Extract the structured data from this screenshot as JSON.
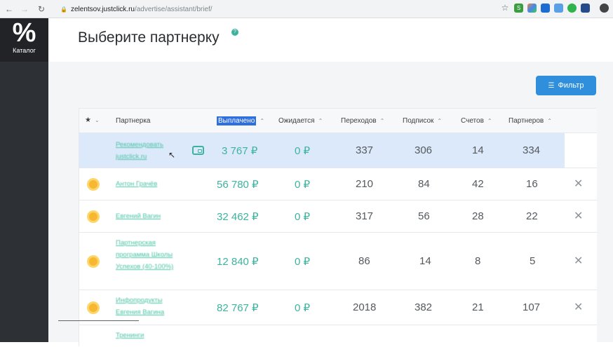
{
  "browser": {
    "url_host": "zelentsov.justclick.ru",
    "url_path": "/advertise/assistant/brief/"
  },
  "sidebar": {
    "catalog_symbol": "%",
    "catalog_label": "Каталог"
  },
  "page": {
    "title": "Выберите партнерку",
    "help_glyph": "?",
    "filter_label": "Фильтр"
  },
  "table": {
    "headers": {
      "star": "★",
      "partner": "Партнерка",
      "paid": "Выплачено",
      "pending": "Ожидается",
      "clicks": "Переходов",
      "subscribers": "Подписок",
      "invoices": "Счетов",
      "partners": "Партнеров"
    },
    "rows": [
      {
        "partner": "Рекомендовать justclick.ru",
        "paid": "3 767 ₽",
        "pending": "0 ₽",
        "clicks": "337",
        "subscribers": "306",
        "invoices": "14",
        "partners": "334"
      },
      {
        "partner": "Антон Грачёв",
        "paid": "56 780 ₽",
        "pending": "0 ₽",
        "clicks": "210",
        "subscribers": "84",
        "invoices": "42",
        "partners": "16"
      },
      {
        "partner": "Евгений Вагин",
        "paid": "32 462 ₽",
        "pending": "0 ₽",
        "clicks": "317",
        "subscribers": "56",
        "invoices": "28",
        "partners": "22"
      },
      {
        "partner": "Партнерская программа Школы Успехов (40-100%)",
        "paid": "12 840 ₽",
        "pending": "0 ₽",
        "clicks": "86",
        "subscribers": "14",
        "invoices": "8",
        "partners": "5"
      },
      {
        "partner": "Инфопродукты Евгения Вагина",
        "paid": "82 767 ₽",
        "pending": "0 ₽",
        "clicks": "2018",
        "subscribers": "382",
        "invoices": "21",
        "partners": "107"
      },
      {
        "partner": "Тренинги",
        "paid": "",
        "pending": "",
        "clicks": "",
        "subscribers": "",
        "invoices": "",
        "partners": ""
      }
    ]
  },
  "colors": {
    "accent": "#3db39e",
    "primary": "#2f8fdc",
    "sidebar": "#2d3034"
  }
}
